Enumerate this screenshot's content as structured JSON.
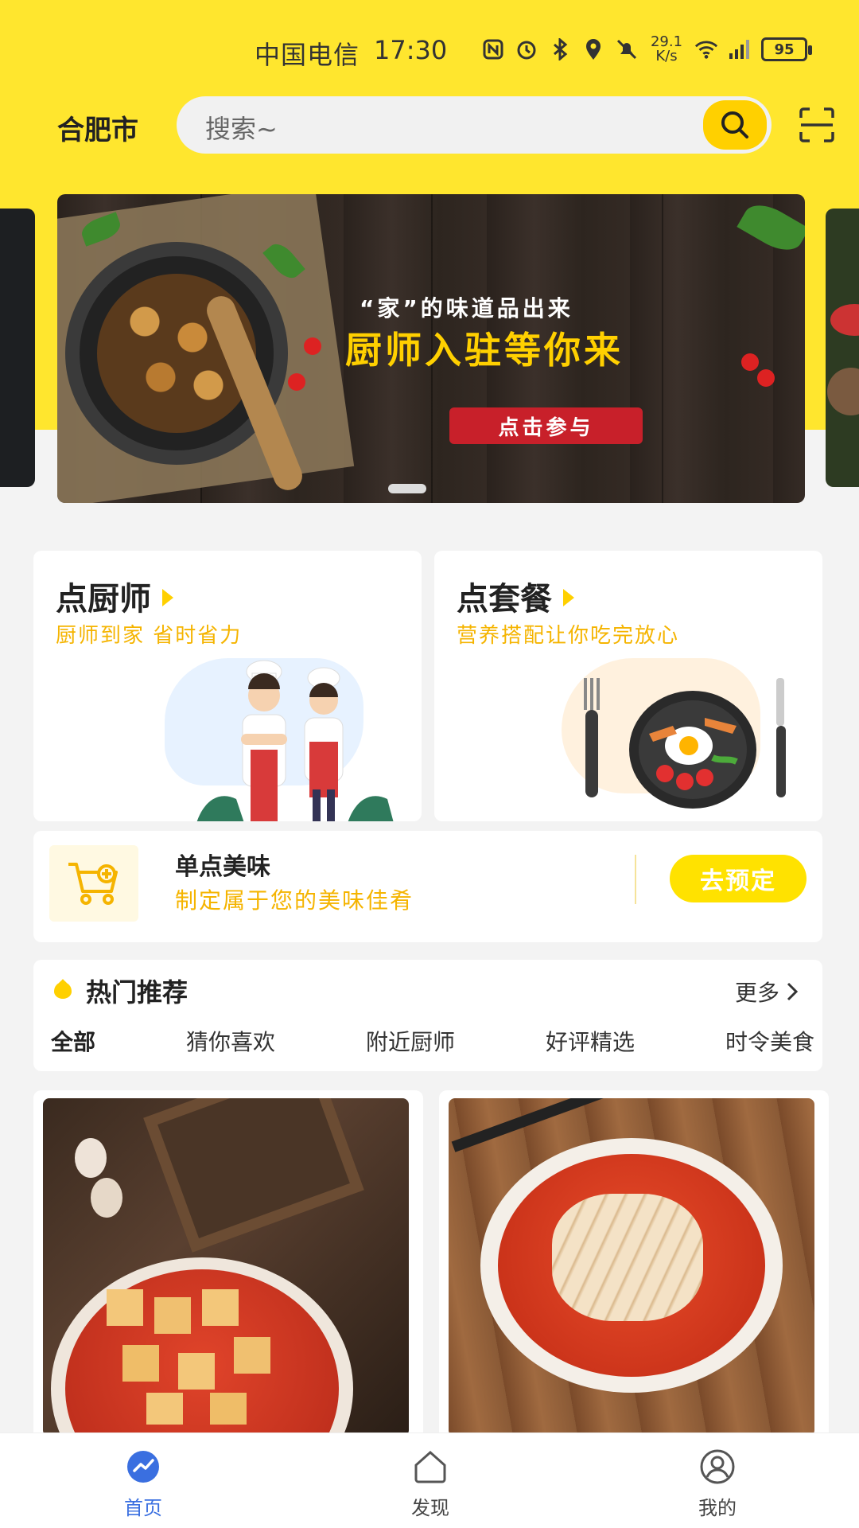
{
  "status_bar": {
    "carrier": "中国电信",
    "time": "17:30",
    "speed_value": "29.1",
    "speed_unit": "K/s",
    "battery": "95"
  },
  "header": {
    "city": "合肥市",
    "search_placeholder": "搜索~"
  },
  "banner": {
    "subtitle": "“家”的味道品出来",
    "title": "厨师入驻等你来",
    "button": "点击参与"
  },
  "cards": {
    "chef": {
      "title": "点厨师",
      "subtitle": "厨师到家 省时省力"
    },
    "set_meal": {
      "title": "点套餐",
      "subtitle": "营养搭配让你吃完放心"
    }
  },
  "single_order": {
    "title": "单点美味",
    "subtitle": "制定属于您的美味佳肴",
    "button": "去预定"
  },
  "hot": {
    "title": "热门推荐",
    "more": "更多",
    "tabs": [
      {
        "label": "全部",
        "active": true
      },
      {
        "label": "猜你喜欢",
        "active": false
      },
      {
        "label": "附近厨师",
        "active": false
      },
      {
        "label": "好评精选",
        "active": false
      },
      {
        "label": "时令美食",
        "active": false
      }
    ]
  },
  "bottom_nav": {
    "items": [
      {
        "label": "首页",
        "icon": "home-icon",
        "active": true
      },
      {
        "label": "发现",
        "icon": "discover-icon",
        "active": false
      },
      {
        "label": "我的",
        "icon": "profile-icon",
        "active": false
      }
    ]
  },
  "colors": {
    "brand_yellow": "#ffe62e",
    "accent_yellow": "#ffd000",
    "nav_active": "#3a6fe0",
    "banner_button": "#c8202a"
  }
}
